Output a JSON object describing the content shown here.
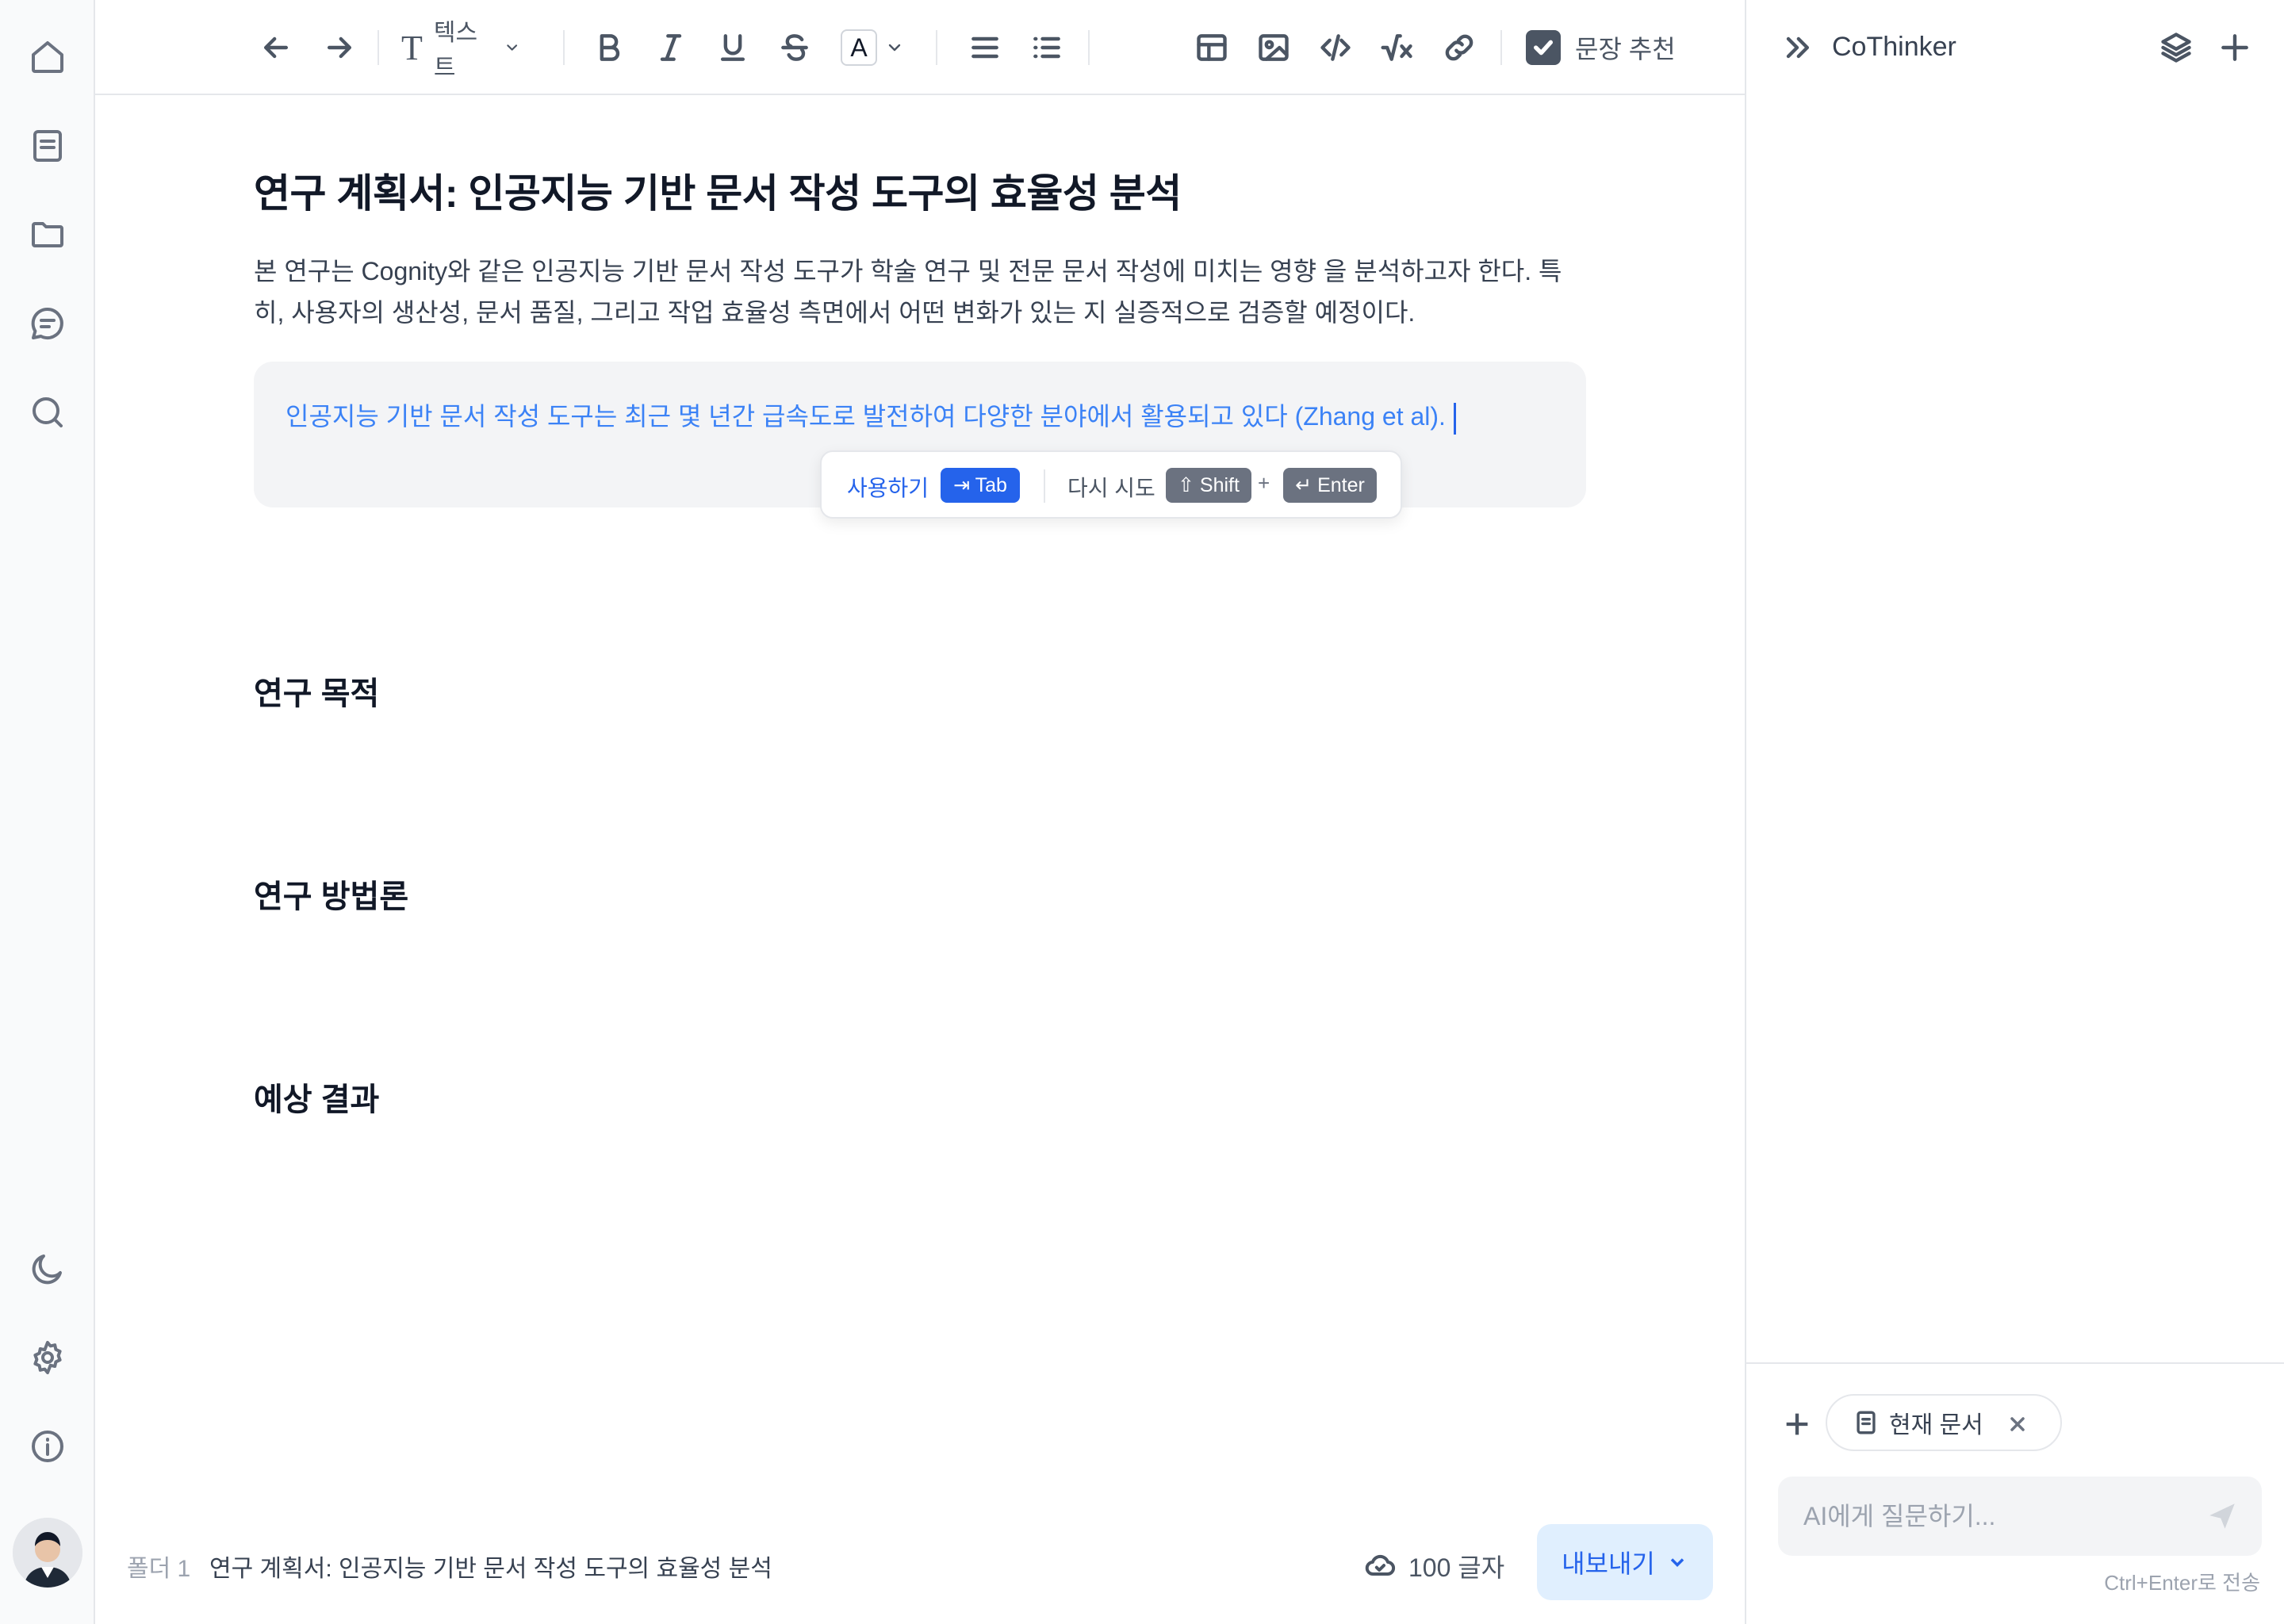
{
  "rail": {
    "items": [
      "home-icon",
      "document-icon",
      "folder-icon",
      "chat-icon",
      "search-icon"
    ],
    "bottom": [
      "moon-icon",
      "gear-icon",
      "info-icon"
    ]
  },
  "toolbar": {
    "text_style": "텍스트",
    "color_letter": "A",
    "sentence_suggest": "문장 추천",
    "sentence_suggest_checked": true
  },
  "document": {
    "title": "연구 계획서: 인공지능 기반 문서 작성 도구의 효율성 분석",
    "intro": "본 연구는 Cognity와 같은 인공지능 기반 문서 작성 도구가 학술 연구 및 전문 문서 작성에 미치는 영향 을 분석하고자 한다. 특히, 사용자의 생산성, 문서 품질, 그리고 작업 효율성 측면에서 어떤 변화가 있는 지 실증적으로 검증할 예정이다.",
    "suggestion": "인공지능 기반 문서 작성 도구는 최근 몇 년간 급속도로 발전하여 다양한 분야에서 활용되고 있다 (Zhang et al).",
    "sections": [
      "연구 목적",
      "연구 방법론",
      "예상 결과"
    ]
  },
  "suggest_popup": {
    "accept_label": "사용하기",
    "accept_key": "⇥ Tab",
    "retry_label": "다시 시도",
    "shift_key": "⇧ Shift",
    "plus": "+",
    "enter_key": "↵ Enter"
  },
  "footer": {
    "folder": "폴더 1",
    "doc_name": "연구 계획서: 인공지능 기반 문서 작성 도구의 효율성 분석",
    "word_count": "100 글자",
    "export_label": "내보내기"
  },
  "panel": {
    "title": "CoThinker",
    "context_chip": "현재 문서",
    "input_placeholder": "AI에게 질문하기...",
    "hint": "Ctrl+Enter로 전송"
  },
  "colors": {
    "accent": "#2563eb",
    "suggestion_text": "#3b82f6",
    "suggestion_bg": "#f3f4f6",
    "export_bg": "#e0effe"
  }
}
